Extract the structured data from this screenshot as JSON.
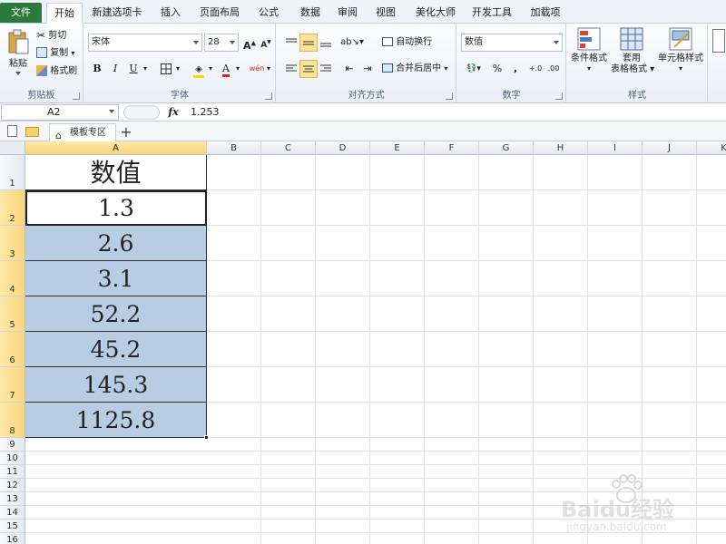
{
  "menu": {
    "tabs": [
      "文件",
      "开始",
      "新建选项卡",
      "插入",
      "页面布局",
      "公式",
      "数据",
      "审阅",
      "视图",
      "美化大师",
      "开发工具",
      "加载项"
    ]
  },
  "ribbon": {
    "clipboard": {
      "paste": "粘贴",
      "cut": "剪切",
      "copy": "复制",
      "format_painter": "格式刷",
      "label": "剪贴板"
    },
    "font": {
      "font_name": "宋体",
      "font_size": "28",
      "label": "字体"
    },
    "alignment": {
      "wrap_text": "自动换行",
      "merge_center": "合并后居中",
      "label": "对齐方式"
    },
    "number": {
      "format": "数值",
      "label": "数字"
    },
    "styles": {
      "conditional": "条件格式",
      "table_line1": "套用",
      "table_line2": "表格格式",
      "cell_styles": "单元格样式",
      "label": "样式"
    }
  },
  "formula_bar": {
    "name_box": "A2",
    "fx": "fx",
    "value": "1.253"
  },
  "workbook_tabs": {
    "template_tab": "模板专区",
    "add": "+"
  },
  "sheet": {
    "columns": [
      "A",
      "B",
      "C",
      "D",
      "E",
      "F",
      "G",
      "H",
      "I",
      "J",
      "K"
    ],
    "rows": [
      "1",
      "2",
      "3",
      "4",
      "5",
      "6",
      "7",
      "8",
      "9",
      "10",
      "11",
      "12",
      "13",
      "14",
      "15",
      "16"
    ],
    "header_cell": "数值",
    "values": [
      "1.3",
      "2.6",
      "3.1",
      "52.2",
      "45.2",
      "145.3",
      "1125.8"
    ],
    "selected_cell": "A2",
    "highlight_color": "#b8cce4"
  },
  "watermark": {
    "brand": "Baidu经验",
    "url": "jingyan.baidu.com"
  },
  "colors": {
    "file_tab": "#2b7a3b",
    "selection_header": "#f9d57a"
  }
}
